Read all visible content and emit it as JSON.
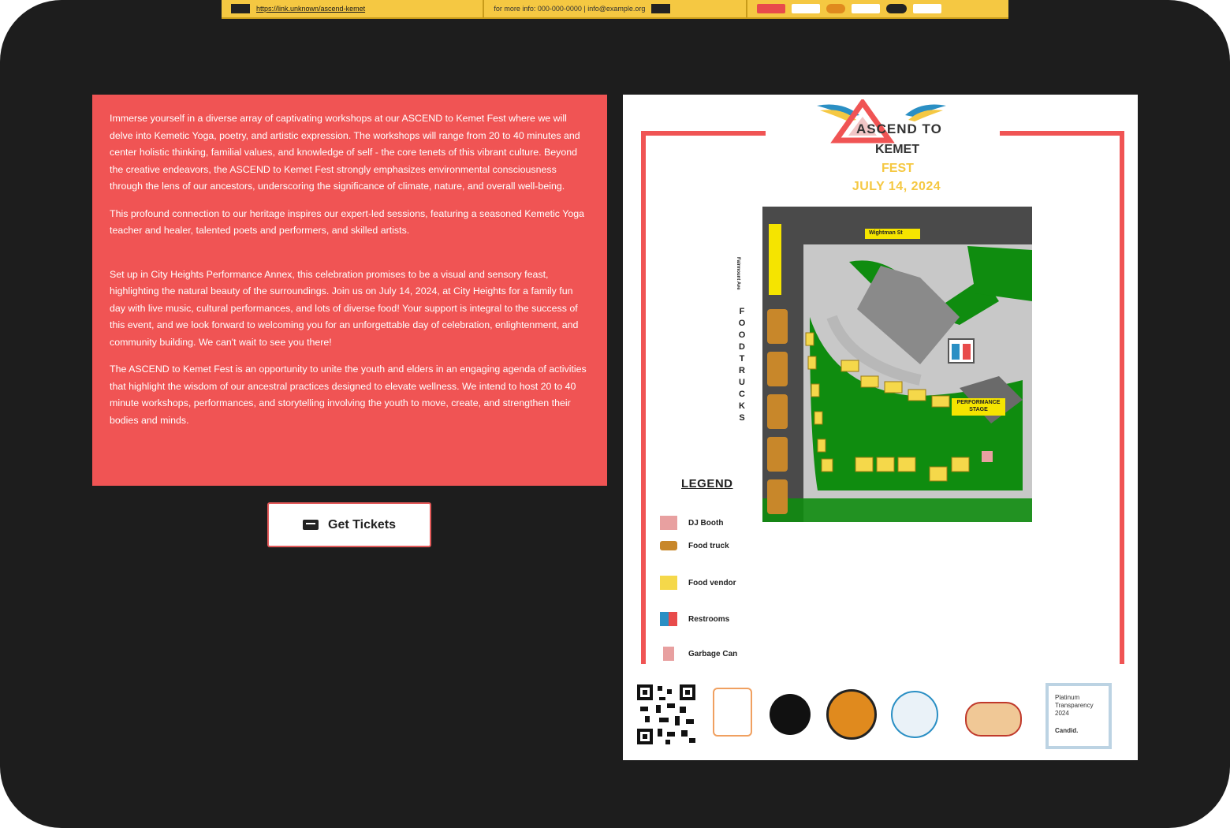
{
  "top_strip": {
    "link_text": "https://link.unknown/ascend-kemet",
    "contact_text": "for more info: 000-000-0000 | info@example.org"
  },
  "description": {
    "paragraphs": [
      "Immerse yourself in a diverse array of captivating workshops at our ASCEND to Kemet Fest where we will delve into Kemetic Yoga, poetry, and artistic expression. The workshops will range from 20 to 40 minutes and center holistic thinking, familial values, and knowledge of self - the core tenets of this vibrant culture. Beyond the creative endeavors, the ASCEND to Kemet Fest strongly emphasizes environmental consciousness through the lens of our ancestors, underscoring the significance of climate, nature, and overall well-being.",
      "This profound connection to our heritage inspires our expert-led sessions, featuring a seasoned Kemetic Yoga teacher and healer, talented poets and performers, and skilled artists.",
      "Set up in City Heights Performance Annex, this celebration promises to be a visual and sensory feast, highlighting the natural beauty of the surroundings. Join us on July 14, 2024, at City Heights for a family fun day with live music, cultural performances, and lots of diverse food! Your support is integral to the success of this event, and we look forward to welcoming you for an unforgettable day of celebration, enlightenment, and community building. We can't wait to see you there!",
      "The ASCEND to Kemet Fest is an opportunity to unite the youth and elders in an engaging agenda of activities that highlight the wisdom of our ancestral practices designed to elevate wellness. We intend to host 20 to 40 minute workshops, performances, and storytelling involving the youth to move, create, and strengthen their bodies and minds."
    ]
  },
  "tickets_button": {
    "label": "Get Tickets",
    "icon": "ticket-icon"
  },
  "flyer": {
    "title_line1": "ASCEND TO",
    "title_line2": "KEMET",
    "title_line3": "FEST",
    "date": "JULY 14, 2024",
    "street_top": "Wightman St",
    "street_side": "Fairmount Ave",
    "stage_label": "PERFORMANCE STAGE",
    "vertical_label": "FOOD TRUCKS",
    "legend_title": "LEGEND",
    "legend": [
      {
        "label": "DJ Booth",
        "icon": "dj-booth-icon"
      },
      {
        "label": "Food truck",
        "icon": "food-truck-icon"
      },
      {
        "label": "Food vendor",
        "icon": "food-vendor-icon"
      },
      {
        "label": "Restrooms",
        "icon": "restroom-icon"
      },
      {
        "label": "Garbage Can",
        "icon": "garbage-can-icon"
      }
    ],
    "badge_text": "Platinum Transparency 2024",
    "badge_sub": "Candid."
  },
  "colors": {
    "background": "#1d1d1d",
    "panel_red": "#f05454",
    "accent_yellow": "#f5c842",
    "grass": "#0f8c0f",
    "road": "#4a4a4a"
  }
}
